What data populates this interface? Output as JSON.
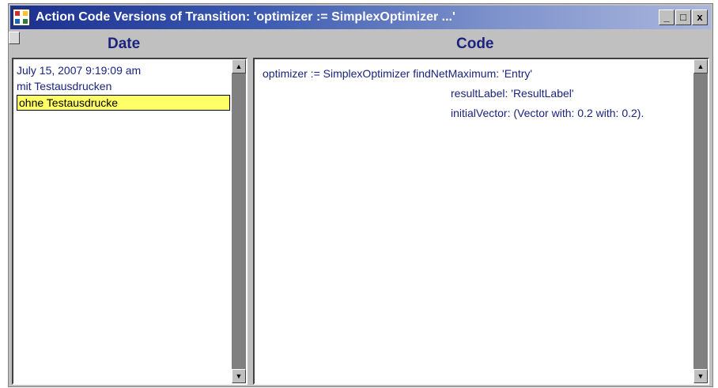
{
  "window": {
    "title": "Action Code Versions of Transition: 'optimizer := SimplexOptimizer  ...'",
    "icon": "app-icon",
    "buttons": {
      "minimize": "_",
      "maximize": "□",
      "close": "x"
    }
  },
  "headers": {
    "date": "Date",
    "code": "Code"
  },
  "versions": [
    {
      "label": "July 15, 2007  9:19:09 am",
      "selected": false
    },
    {
      "label": "mit Testausdrucken",
      "selected": false
    },
    {
      "label": "ohne Testausdrucke",
      "selected": true
    }
  ],
  "code_lines": [
    "optimizer := SimplexOptimizer findNetMaximum: 'Entry'",
    "resultLabel: 'ResultLabel'",
    "initialVector:  (Vector with: 0.2 with: 0.2)."
  ],
  "colors": {
    "title_start": "#1b2f8f",
    "text_blue": "#1a237e",
    "selection": "#ffff66"
  }
}
